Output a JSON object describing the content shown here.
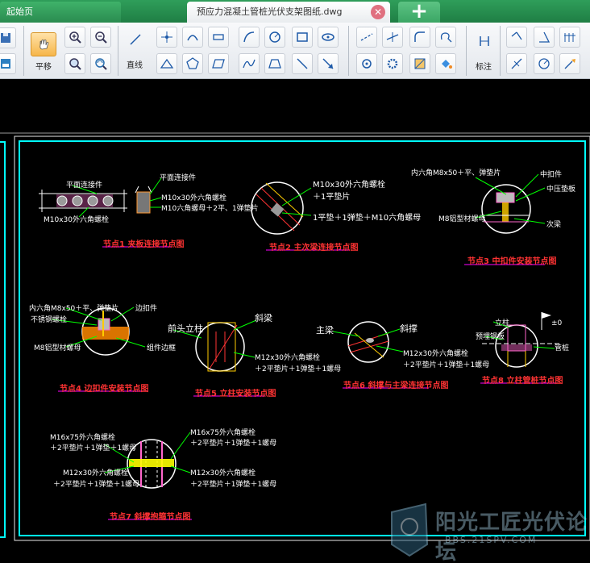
{
  "tabs": {
    "home_label": "起始页",
    "active_label": "预应力混凝土管桩光伏支架图纸.dwg",
    "close_glyph": "✕",
    "new_glyph": "+"
  },
  "toolbar": {
    "pan_label": "平移",
    "line_label": "直线",
    "dimension_label": "标注"
  },
  "drawing": {
    "node1": {
      "caption": "节点1  夹板连接节点图",
      "clip_label": "平面连接件",
      "clip_label_side": "平面连接件",
      "bolt_label": "M10x30外六角螺栓",
      "bolt_label_side": "M10x30外六角螺栓",
      "washer_label_side": "M10六角螺母＋2平、1弹垫片"
    },
    "node2": {
      "caption": "节点2  主次梁连接节点图",
      "bolt_label": "M10x30外六角螺栓",
      "washer_label": "＋1平垫片",
      "nut_label": "1平垫＋1弹垫＋M10六角螺母"
    },
    "node3": {
      "caption": "节点3  中扣件安装节点图",
      "top_label": "内六角M8x50＋平、弹垫片",
      "clamp_label": "中扣件",
      "panel_label": "中压垫板",
      "bolt_label": "M8铝型材螺母",
      "beam_label": "次梁"
    },
    "node4": {
      "caption": "节点4  边扣件安装节点图",
      "top_label": "内六角M8x50＋平、弹垫片",
      "clamp_label": "边扣件",
      "steel_label": "不锈钢螺栓",
      "nut_label": "M8铝型材螺母",
      "module_label": "组件边框"
    },
    "node5": {
      "caption": "节点5  立柱安装节点图",
      "column_label": "前头立柱",
      "brace_label": "斜梁",
      "bolt_label": "M12x30外六角螺栓",
      "washer_label": "＋2平垫片＋1弹垫＋1螺母"
    },
    "node6": {
      "caption": "节点6  斜撑与主梁连接节点图",
      "main_label": "主梁",
      "brace_label": "斜撑",
      "bolt_label": "M12x30外六角螺栓",
      "washer_label": "＋2平垫片＋1弹垫＋1螺母"
    },
    "node7": {
      "caption": "节点7  斜撑抱箍节点图",
      "bolt_top_left": "M16x75外六角螺栓",
      "washer_top_left": "＋2平垫片＋1弹垫＋1螺母",
      "bolt_top_right": "M16x75外六角螺栓",
      "washer_top_right": "＋2平垫片＋1弹垫＋1螺母",
      "bolt_bottom_left": "M12x30外六角螺栓",
      "washer_bottom_left": "＋2平垫片＋1弹垫＋1螺母",
      "bolt_bottom_right": "M12x30外六角螺栓",
      "washer_bottom_right": "＋2平垫片＋1弹垫＋1螺母"
    },
    "node8": {
      "caption": "节点8  立柱管桩节点图",
      "column_label": "立柱",
      "embed_label": "预埋钢板",
      "pile_label": "管桩",
      "level_label": "±0"
    }
  },
  "watermark": {
    "text": "阳光工匠光伏论坛",
    "url": "BBS.21SPV.COM"
  },
  "colors": {
    "frame": "#00ffff",
    "caption": "#ff3333",
    "leader": "#00ff00",
    "circle": "#ffffff",
    "caption_underline": "#ff00ff"
  }
}
